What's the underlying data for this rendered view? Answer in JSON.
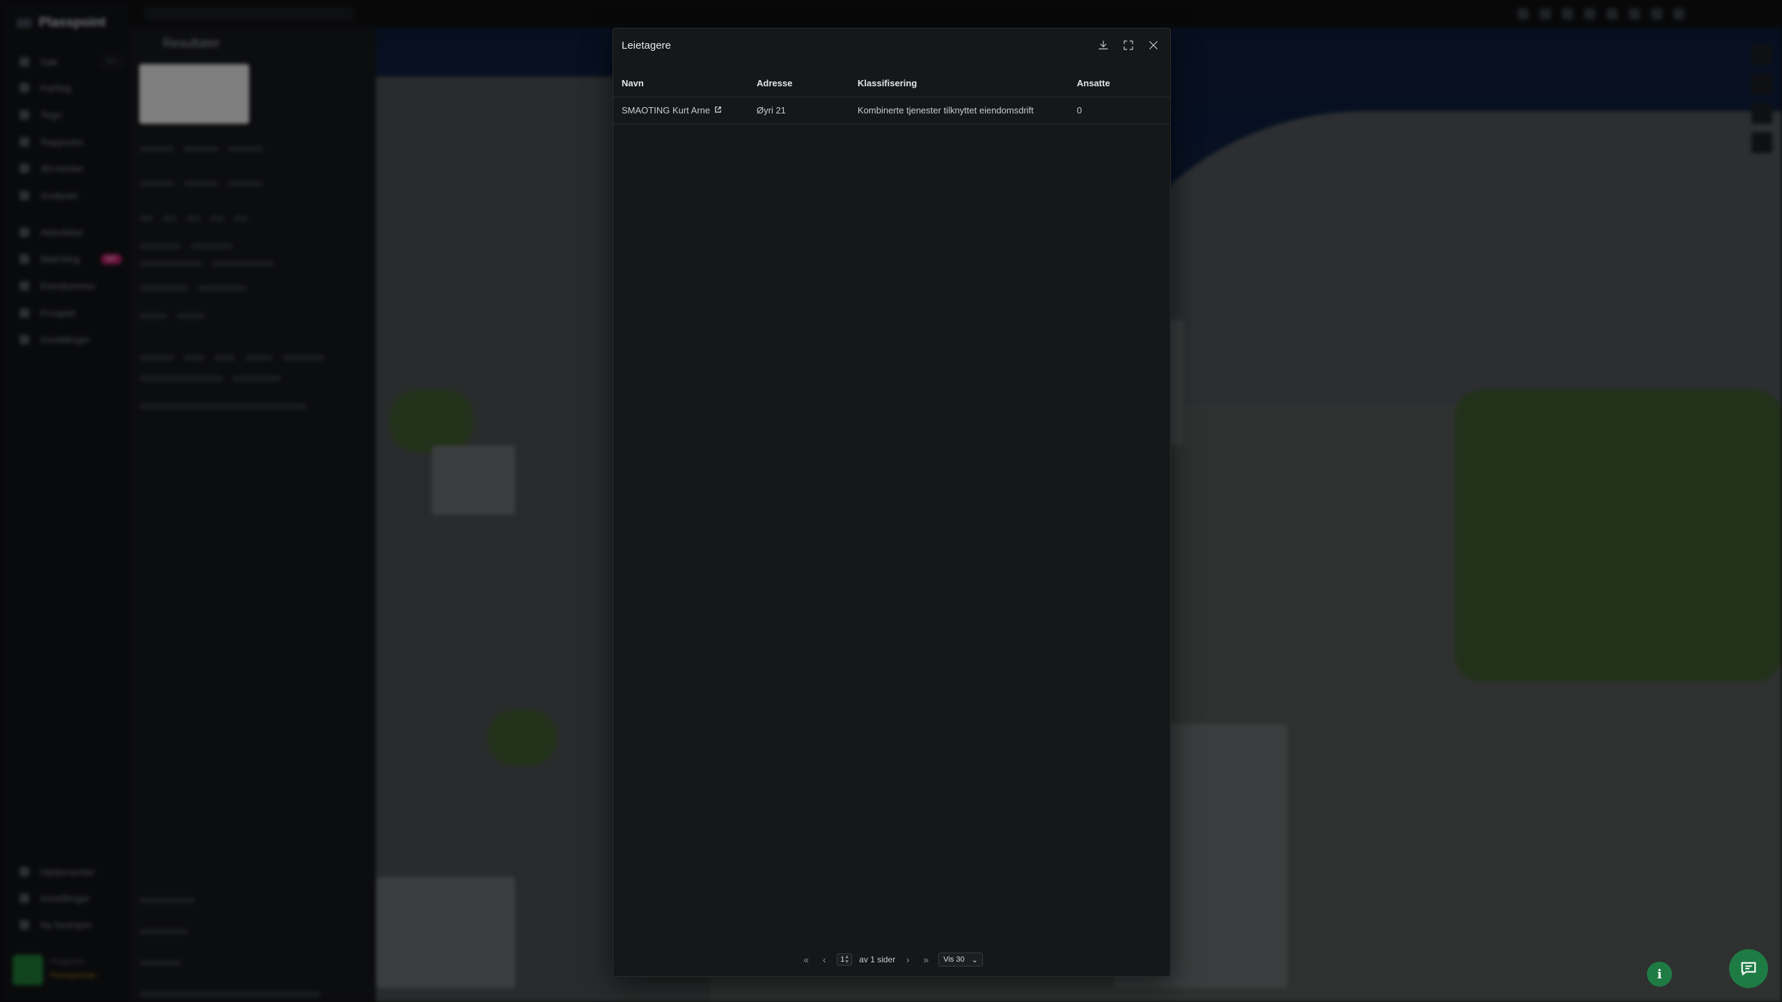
{
  "app": {
    "logo_text": "Plasspoint",
    "nav": [
      {
        "label": "Søk",
        "kbd": "⌘K"
      },
      {
        "label": "Kartlag"
      },
      {
        "label": "Tegn"
      },
      {
        "label": "Rapporter"
      },
      {
        "label": "3D-tomter"
      },
      {
        "label": "Analyser"
      },
      {
        "label": "Aktiviteter"
      },
      {
        "label": "Matching",
        "badge": "NY"
      },
      {
        "label": "Eiendommer"
      },
      {
        "label": "Prosjekt"
      },
      {
        "label": "Innstillinger"
      }
    ],
    "nav_bottom": [
      {
        "label": "Hjelpesenter"
      },
      {
        "label": "Innstillinger"
      },
      {
        "label": "Ny funksjon"
      }
    ],
    "user": {
      "name": "Pluggsvar",
      "status": "Prøveperiode"
    },
    "panel_title": "Resultater"
  },
  "modal": {
    "title": "Leietagere",
    "actions": {
      "download": "download-icon",
      "expand": "expand-icon",
      "close": "close-icon"
    },
    "columns": [
      "Navn",
      "Adresse",
      "Klassifisering",
      "Ansatte"
    ],
    "rows": [
      {
        "navn": "SMAOTING Kurt Arne",
        "adresse": "Øyri 21",
        "klassifisering": "Kombinerte tjenester tilknyttet eiendomsdrift",
        "ansatte": "0"
      }
    ],
    "pagination": {
      "page": "1",
      "of_text": "av 1 sider",
      "page_size": "Vis 30"
    }
  },
  "colors": {
    "modal_bg": "#161719",
    "fab_green": "#1f7b44",
    "badge_pink": "#c0236f"
  }
}
